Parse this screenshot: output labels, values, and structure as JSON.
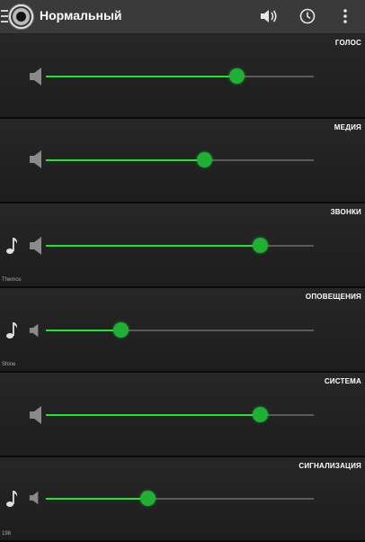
{
  "app": {
    "title": "Нормальный"
  },
  "icons": {
    "menu": "hamburger-menu-icon",
    "app": "speaker-cone-icon",
    "sound_profile": "speaker-wave-icon",
    "schedule": "clock-icon",
    "overflow": "more-vertical-icon",
    "volume": "speaker-icon",
    "ringtone": "music-note-icon"
  },
  "colors": {
    "accent": "#1ee82e",
    "thumb": "#20b033",
    "toolbar": "#3a3a3a",
    "track": "#5a5a5a"
  },
  "streams": [
    {
      "label": "ГОЛОС",
      "level": 0.71,
      "note": "",
      "has_ringtone": false
    },
    {
      "label": "МЕДИЯ",
      "level": 0.59,
      "note": "",
      "has_ringtone": false
    },
    {
      "label": "ЗВОНКИ",
      "level": 0.8,
      "note": "Themos",
      "has_ringtone": true
    },
    {
      "label": "ОПОВЕЩЕНИЯ",
      "level": 0.28,
      "note": "Shine",
      "has_ringtone": true
    },
    {
      "label": "СИСТЕМА",
      "level": 0.8,
      "note": "",
      "has_ringtone": false
    },
    {
      "label": "СИГНАЛИЗАЦИЯ",
      "level": 0.38,
      "note": "198",
      "has_ringtone": true
    }
  ]
}
